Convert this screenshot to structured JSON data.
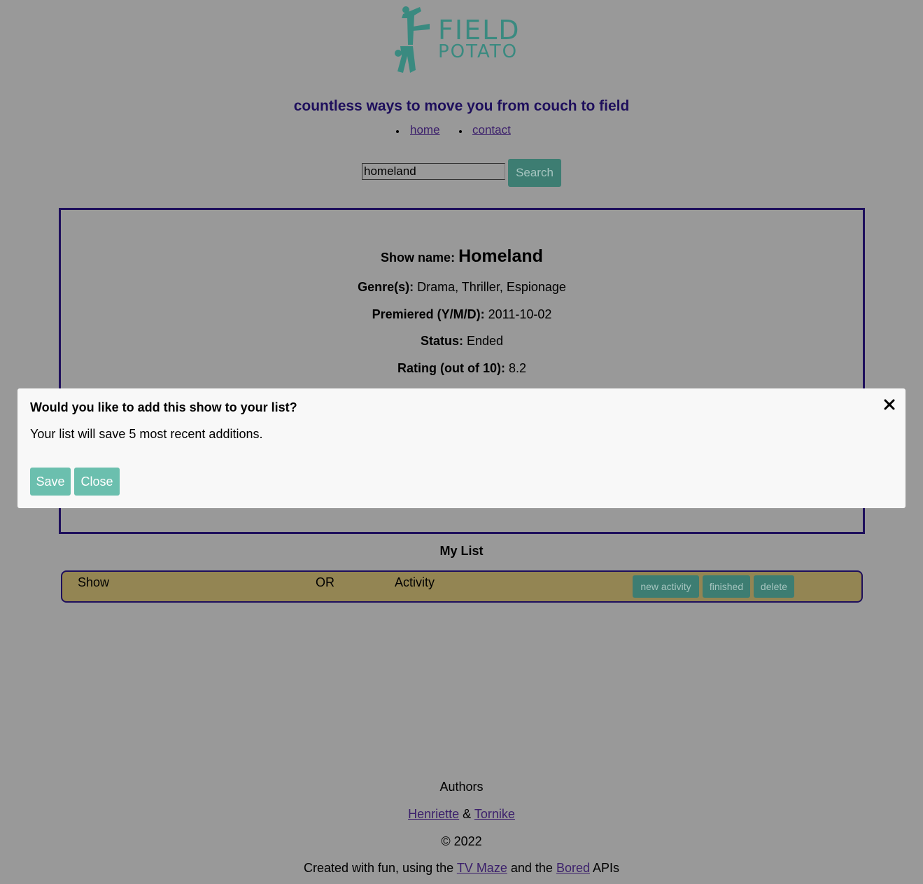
{
  "brand": {
    "line1": "FIELD",
    "line2": "POTATO",
    "color": "#4a9e93"
  },
  "tagline": "countless ways to move you from couch to field",
  "nav": {
    "items": [
      "home",
      "contact"
    ]
  },
  "search": {
    "value": "homeland",
    "button": "Search"
  },
  "show": {
    "name_label": "Show name:",
    "name": "Homeland",
    "genres_label": "Genre(s):",
    "genres": "Drama, Thriller, Espionage",
    "premiered_label": "Premiered (Y/M/D):",
    "premiered": "2011-10-02",
    "status_label": "Status:",
    "status": "Ended",
    "rating_label": "Rating (out of 10):",
    "rating": "8.2"
  },
  "my_list": {
    "title": "My List",
    "row": {
      "show": "Show",
      "or": "OR",
      "activity": "Activity",
      "buttons": [
        "new activity",
        "finished",
        "delete"
      ]
    }
  },
  "footer": {
    "authors_label": "Authors",
    "author1": "Henriette",
    "amp": "&",
    "author2": "Tornike",
    "copyright": "© 2022",
    "credit_prefix": "Created with fun, using the",
    "api1": "TV Maze",
    "credit_mid": "and the",
    "api2": "Bored",
    "credit_suffix": "APIs"
  },
  "modal": {
    "title": "Would you like to add this show to your list?",
    "body": "Your list will save 5 most recent additions.",
    "save": "Save",
    "close": "Close"
  },
  "colors": {
    "overlay_bg": "#999999",
    "accent_dark": "#1e0f5c",
    "button": "#3d7d72",
    "modal_button": "#6bbfae",
    "list_row": "#938553"
  }
}
